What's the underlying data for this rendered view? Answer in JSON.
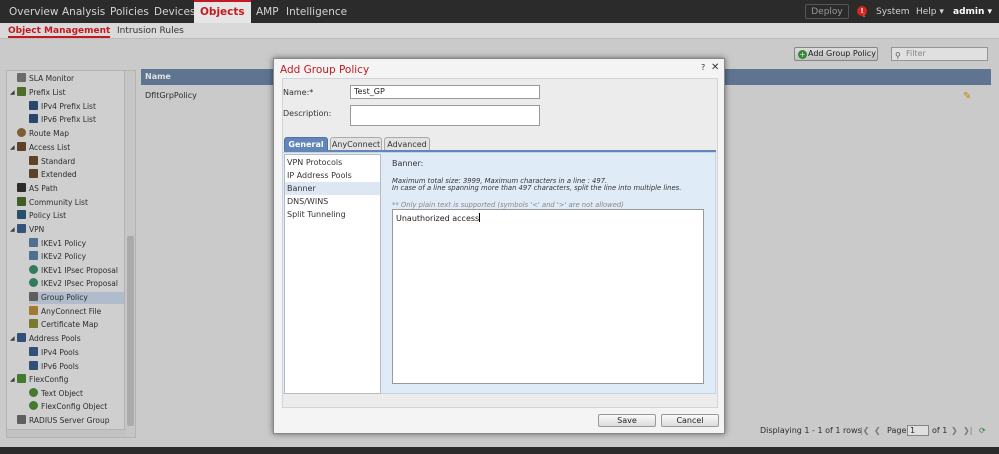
{
  "topnav": {
    "tabs": [
      "Overview",
      "Analysis",
      "Policies",
      "Devices",
      "Objects",
      "AMP",
      "Intelligence"
    ],
    "deploy": "Deploy",
    "alert": "!",
    "alert_count": "1",
    "system": "System",
    "help": "Help ▾",
    "user": "admin ▾"
  },
  "subnav": {
    "active": "Object Management",
    "other": "Intrusion Rules"
  },
  "toolbar": {
    "add_group_policy": "Add Group Policy",
    "filter_placeholder": "Filter"
  },
  "tree": {
    "items": [
      {
        "label": "SLA Monitor",
        "color": "#7a7a7a"
      },
      {
        "label": "Prefix List",
        "color": "#5b7d2f"
      },
      {
        "label": "IPv4 Prefix List",
        "color": "#2f4f7a"
      },
      {
        "label": "IPv6 Prefix List",
        "color": "#2f4f7a"
      },
      {
        "label": "Route Map",
        "color": "#8a6d3b"
      },
      {
        "label": "Access List",
        "color": "#6b4a2f"
      },
      {
        "label": "Standard",
        "color": "#6b4a2f"
      },
      {
        "label": "Extended",
        "color": "#6b4a2f"
      },
      {
        "label": "AS Path",
        "color": "#333333"
      },
      {
        "label": "Community List",
        "color": "#4a6b2f"
      },
      {
        "label": "Policy List",
        "color": "#2f5b7a"
      },
      {
        "label": "VPN",
        "color": "#3d5f8a"
      },
      {
        "label": "IKEv1 Policy",
        "color": "#5a7fa8"
      },
      {
        "label": "IKEv2 Policy",
        "color": "#5a7fa8"
      },
      {
        "label": "IKEv1 IPsec Proposal",
        "color": "#3b8c6a"
      },
      {
        "label": "IKEv2 IPsec Proposal",
        "color": "#3b8c6a"
      },
      {
        "label": "Group Policy",
        "color": "#6b6b6b"
      },
      {
        "label": "AnyConnect File",
        "color": "#b88a3a"
      },
      {
        "label": "Certificate Map",
        "color": "#8a8a3a"
      },
      {
        "label": "Address Pools",
        "color": "#3a5a8a"
      },
      {
        "label": "IPv4 Pools",
        "color": "#3a5a8a"
      },
      {
        "label": "IPv6 Pools",
        "color": "#3a5a8a"
      },
      {
        "label": "FlexConfig",
        "color": "#4f8a3a"
      },
      {
        "label": "Text Object",
        "color": "#4f8a3a"
      },
      {
        "label": "FlexConfig Object",
        "color": "#4f8a3a"
      },
      {
        "label": "RADIUS Server Group",
        "color": "#6b6b6b"
      }
    ],
    "selected": "Group Policy"
  },
  "grid": {
    "header": "Name",
    "rows": [
      "DfltGrpPolicy"
    ],
    "footer": "Displaying 1 - 1 of 1 rows",
    "page_label": "Page",
    "page_value": "1",
    "of_pages": "of 1"
  },
  "modal": {
    "title": "Add Group Policy",
    "help": "?",
    "close": "✕",
    "name_label": "Name:*",
    "name_value": "Test_GP",
    "description_label": "Description:",
    "description_value": "",
    "tabs": [
      "General",
      "AnyConnect",
      "Advanced"
    ],
    "active_tab": "General",
    "side_items": [
      "VPN Protocols",
      "IP Address Pools",
      "Banner",
      "DNS/WINS",
      "Split Tunneling"
    ],
    "selected_side": "Banner",
    "banner_label": "Banner:",
    "info_line1": "Maximum total size: 3999, Maximum characters in a line : 497.",
    "info_line2": "In case of a line spanning more than 497 characters, split the line into multiple lines.",
    "note": "** Only plain text is supported (symbols '<' and '>' are not allowed)",
    "banner_text": "Unauthorized access",
    "save": "Save",
    "cancel": "Cancel"
  }
}
